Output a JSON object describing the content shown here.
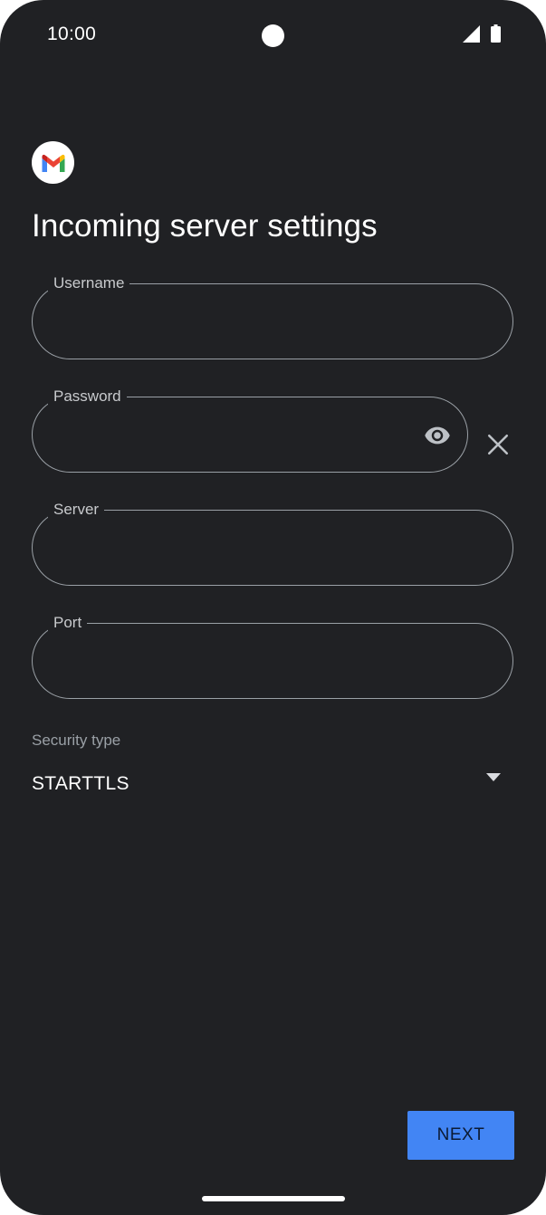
{
  "status_bar": {
    "time": "10:00",
    "icons": [
      "signal-icon",
      "battery-icon"
    ]
  },
  "app": {
    "logo_icon": "gmail-logo-icon"
  },
  "page": {
    "title": "Incoming server settings"
  },
  "form": {
    "username": {
      "label": "Username",
      "value": ""
    },
    "password": {
      "label": "Password",
      "value": "",
      "toggle_icon": "eye-icon",
      "clear_icon": "close-icon"
    },
    "server": {
      "label": "Server",
      "value": ""
    },
    "port": {
      "label": "Port",
      "value": ""
    },
    "security": {
      "label": "Security type",
      "selected": "STARTTLS",
      "icon": "dropdown-arrow-icon"
    }
  },
  "actions": {
    "next_label": "NEXT"
  },
  "colors": {
    "background": "#202124",
    "primary": "#4285f4",
    "outline": "#9aa0a6"
  }
}
